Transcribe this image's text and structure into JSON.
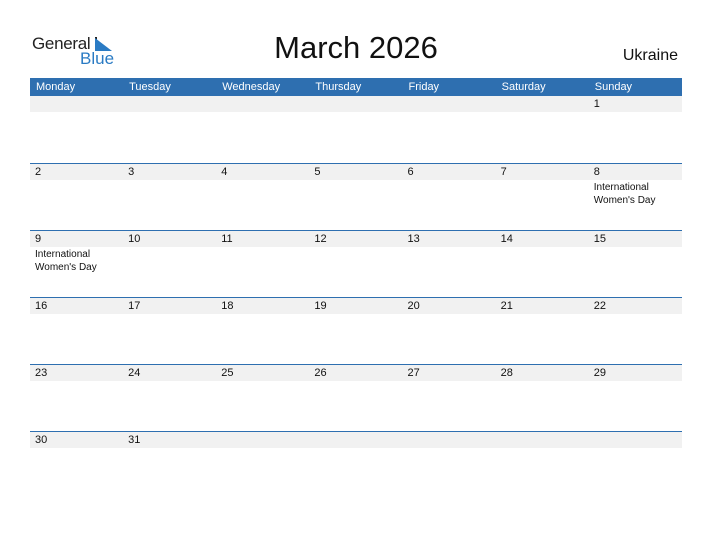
{
  "logo": {
    "line1": "General",
    "line2": "Blue"
  },
  "title": "March 2026",
  "country": "Ukraine",
  "weekdays": [
    "Monday",
    "Tuesday",
    "Wednesday",
    "Thursday",
    "Friday",
    "Saturday",
    "Sunday"
  ],
  "weeks": [
    [
      {
        "d": ""
      },
      {
        "d": ""
      },
      {
        "d": ""
      },
      {
        "d": ""
      },
      {
        "d": ""
      },
      {
        "d": ""
      },
      {
        "d": "1"
      }
    ],
    [
      {
        "d": "2"
      },
      {
        "d": "3"
      },
      {
        "d": "4"
      },
      {
        "d": "5"
      },
      {
        "d": "6"
      },
      {
        "d": "7"
      },
      {
        "d": "8",
        "event": "International Women's Day"
      }
    ],
    [
      {
        "d": "9",
        "event": "International Women's Day"
      },
      {
        "d": "10"
      },
      {
        "d": "11"
      },
      {
        "d": "12"
      },
      {
        "d": "13"
      },
      {
        "d": "14"
      },
      {
        "d": "15"
      }
    ],
    [
      {
        "d": "16"
      },
      {
        "d": "17"
      },
      {
        "d": "18"
      },
      {
        "d": "19"
      },
      {
        "d": "20"
      },
      {
        "d": "21"
      },
      {
        "d": "22"
      }
    ],
    [
      {
        "d": "23"
      },
      {
        "d": "24"
      },
      {
        "d": "25"
      },
      {
        "d": "26"
      },
      {
        "d": "27"
      },
      {
        "d": "28"
      },
      {
        "d": "29"
      }
    ],
    [
      {
        "d": "30"
      },
      {
        "d": "31"
      },
      {
        "d": ""
      },
      {
        "d": ""
      },
      {
        "d": ""
      },
      {
        "d": ""
      },
      {
        "d": ""
      }
    ]
  ],
  "colors": {
    "header": "#2e6fb0",
    "brand_blue": "#2a7bc4",
    "day_strip": "#f1f1f1"
  }
}
